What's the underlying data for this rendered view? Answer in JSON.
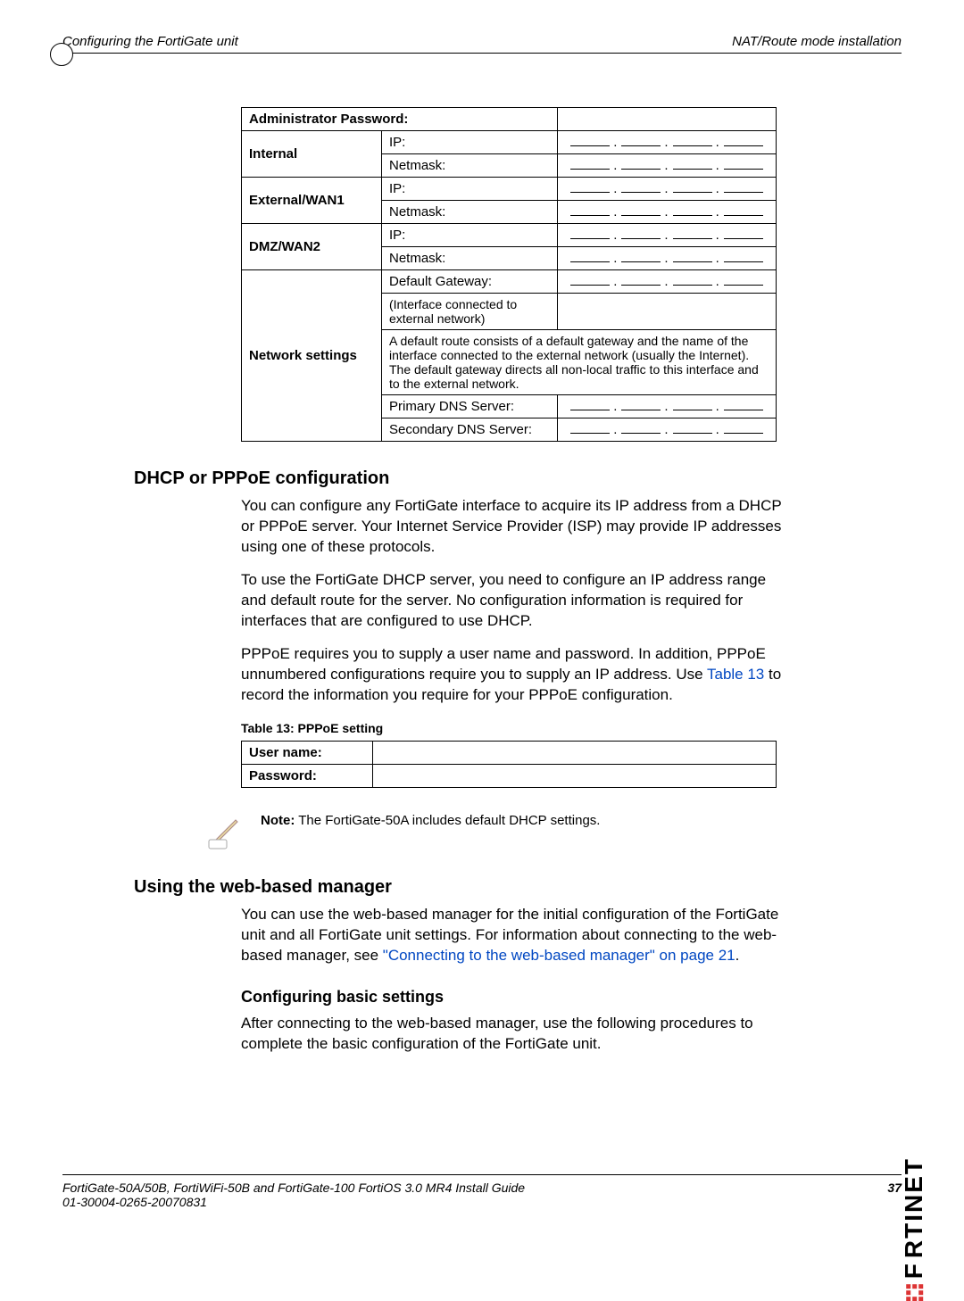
{
  "header": {
    "left": "Configuring the FortiGate unit",
    "right": "NAT/Route mode installation"
  },
  "cfgTable": {
    "adminPwd": "Administrator Password:",
    "internal": {
      "label": "Internal",
      "ip": "IP:",
      "netmask": "Netmask:"
    },
    "external": {
      "label": "External/WAN1",
      "ip": "IP:",
      "netmask": "Netmask:"
    },
    "dmz": {
      "label": "DMZ/WAN2",
      "ip": "IP:",
      "netmask": "Netmask:"
    },
    "net": {
      "label": "Network settings",
      "gateway": "Default Gateway:",
      "iface": "(Interface connected to external network)",
      "note": "A default route consists of a default gateway and the name of the interface connected to the external network (usually the Internet). The default gateway directs all non-local traffic to this interface and to the external network.",
      "dns1": "Primary DNS Server:",
      "dns2": "Secondary DNS Server:"
    }
  },
  "sec1": {
    "title": "DHCP or PPPoE configuration",
    "p1": "You can configure any FortiGate interface to acquire its IP address from a DHCP or PPPoE server. Your Internet Service Provider (ISP) may provide IP addresses using one of these protocols.",
    "p2": "To use the FortiGate DHCP server, you need to configure an IP address range and default route for the server. No configuration information is required for interfaces that are configured to use DHCP.",
    "p3a": "PPPoE requires you to supply a user name and password. In addition, PPPoE unnumbered configurations require you to supply an IP address. Use ",
    "p3link": "Table 13",
    "p3b": " to record the information you require for your PPPoE configuration.",
    "tableCaption": "Table 13: PPPoE setting",
    "user": "User name:",
    "pwd": "Password:"
  },
  "note": {
    "bold": "Note:",
    "text": " The FortiGate-50A includes default DHCP settings."
  },
  "sec2": {
    "title": "Using the web-based manager",
    "p1a": "You can use the web-based manager for the initial configuration of the FortiGate unit and all FortiGate unit settings. For information about connecting to the web-based manager, see ",
    "p1link": "\"Connecting to the web-based manager\" on page 21",
    "p1b": "."
  },
  "sec3": {
    "title": "Configuring basic settings",
    "p1": "After connecting to the web-based manager, use the following procedures to complete the basic configuration of the FortiGate unit."
  },
  "footer": {
    "l1": "FortiGate-50A/50B, FortiWiFi-50B and FortiGate-100 FortiOS 3.0 MR4 Install Guide",
    "l2": "01-30004-0265-20070831",
    "page": "37"
  },
  "brand": "RTINET"
}
